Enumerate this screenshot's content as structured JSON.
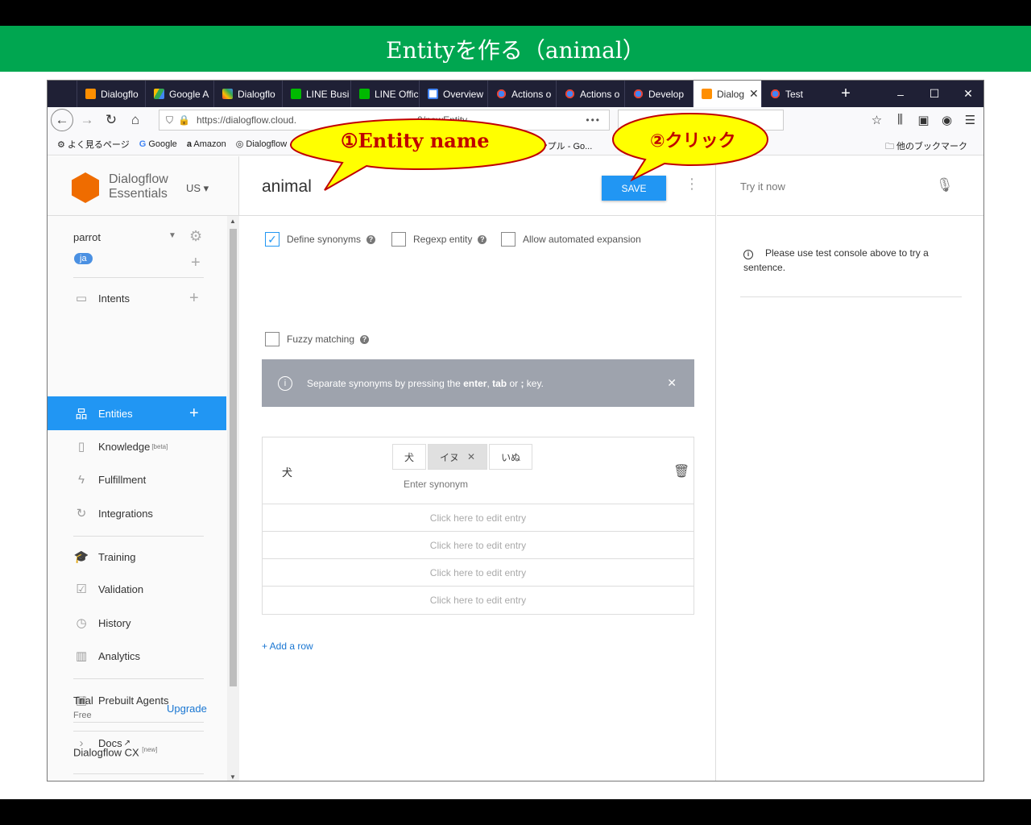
{
  "slide": {
    "title": "Entityを作る（animal）"
  },
  "browser": {
    "tabs": [
      {
        "label": "Dialogflo",
        "color": "#ff8f00"
      },
      {
        "label": "Google A",
        "color": "#34a853"
      },
      {
        "label": "Dialogflo",
        "color": "#ea4335"
      },
      {
        "label": "LINE Busi",
        "color": "#00b900"
      },
      {
        "label": "LINE Offic",
        "color": "#00b900"
      },
      {
        "label": "Overview",
        "color": "#4285f4"
      },
      {
        "label": "Actions o",
        "color": "#4285f4"
      },
      {
        "label": "Actions o",
        "color": "#4285f4"
      },
      {
        "label": "Develop",
        "color": "#4285f4"
      },
      {
        "label": "Dialog",
        "color": "#ff8f00",
        "active": true
      },
      {
        "label": "Test",
        "color": "#4285f4"
      }
    ],
    "window_controls": {
      "minimize": "–",
      "maximize": "☐",
      "close": "✕"
    },
    "url": "https://dialogflow.cloud.",
    "url_tail": "0/newEntity",
    "bookmarks": {
      "items": [
        "よく見るページ",
        "Google",
        "Amazon",
        "Dialogflow"
      ],
      "mid": "ンプル - Go...",
      "other": "他のブックマーク"
    }
  },
  "sidebar": {
    "logo_line1": "Dialogflow",
    "logo_line2": "Essentials",
    "region": "US",
    "agent": "parrot",
    "language": "ja",
    "menu": {
      "intents": "Intents",
      "entities": "Entities",
      "knowledge": "Knowledge",
      "knowledge_badge": "[beta]",
      "fulfillment": "Fulfillment",
      "integrations": "Integrations",
      "training": "Training",
      "validation": "Validation",
      "history": "History",
      "analytics": "Analytics",
      "prebuilt": "Prebuilt Agents",
      "docs": "Docs"
    },
    "trial": "Trial",
    "trial_sub": "Free",
    "upgrade": "Upgrade",
    "cx": "Dialogflow CX",
    "cx_badge": "[new]"
  },
  "main": {
    "entity_name": "animal",
    "save": "SAVE",
    "options": {
      "define_synonyms": "Define synonyms",
      "regexp": "Regexp entity",
      "allow_expansion": "Allow automated expansion",
      "fuzzy": "Fuzzy matching"
    },
    "banner": {
      "prefix": "Separate synonyms by pressing the ",
      "k1": "enter",
      "sep1": ", ",
      "k2": "tab",
      "mid": " or ",
      "k3": ";",
      "suffix": " key."
    },
    "entry": {
      "reference": "犬",
      "synonyms": [
        "犬",
        "イヌ",
        "いぬ"
      ],
      "placeholder": "Enter synonym"
    },
    "empty_rows": [
      "Click here to edit entry",
      "Click here to edit entry",
      "Click here to edit entry",
      "Click here to edit entry"
    ],
    "add_row": "+ Add a row"
  },
  "right_panel": {
    "try_it": "Try it now",
    "info": "Please use test console above to try a sentence."
  },
  "callouts": {
    "one": "①Entity name",
    "two": "②クリック"
  },
  "colors": {
    "slide_green": "#00a650",
    "accent": "#2196f3",
    "callout_fill": "#ffff00",
    "callout_text": "#c00000"
  }
}
